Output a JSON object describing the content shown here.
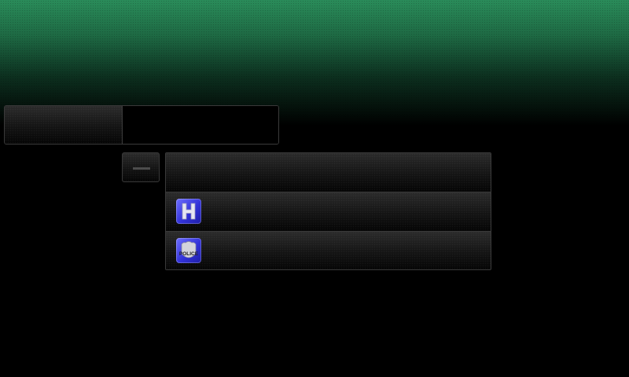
{
  "top_panel": {},
  "collapse_button": {
    "icon": "minus-icon"
  },
  "list": {
    "items": [
      {
        "icon": ""
      },
      {
        "icon": "hospital-icon"
      },
      {
        "icon": "police-badge-icon",
        "icon_text": "POLICE"
      }
    ]
  },
  "colors": {
    "header_green": "#2a8c5a",
    "icon_blue": "#3232d8",
    "border": "#3a3a3a"
  }
}
